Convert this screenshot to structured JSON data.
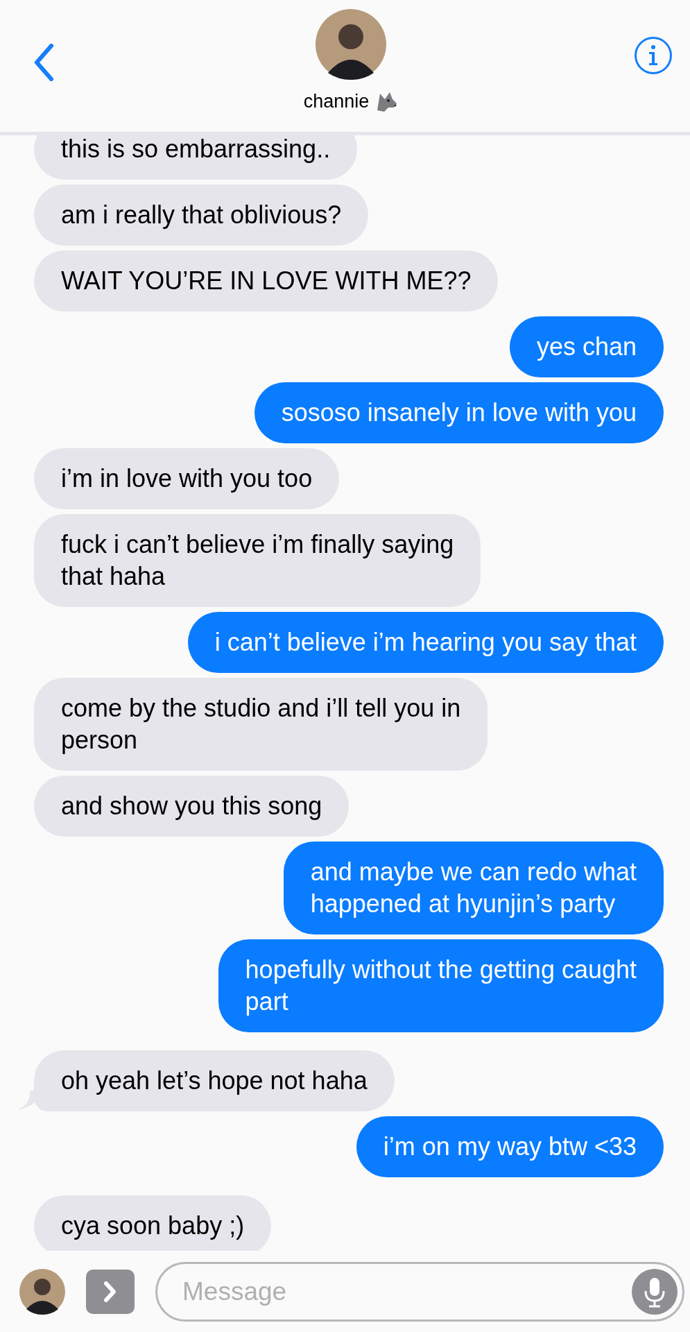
{
  "header": {
    "contact_name": "channie"
  },
  "groups": [
    {
      "messages": [
        {
          "kind": "received",
          "text": "this is so embarrassing..",
          "tail": false
        },
        {
          "kind": "received",
          "text": "am i really that oblivious?",
          "tail": false
        },
        {
          "kind": "received",
          "text": "WAIT YOU’RE IN LOVE WITH ME??",
          "tail": false
        },
        {
          "kind": "sent",
          "text": "yes chan",
          "tail": false
        },
        {
          "kind": "sent",
          "text": "sososo insanely in love with you",
          "tail": false
        },
        {
          "kind": "received",
          "text": "i’m in love with you too",
          "tail": false
        },
        {
          "kind": "received",
          "text": "fuck i can’t believe i’m finally saying\nthat haha",
          "tail": false
        },
        {
          "kind": "sent",
          "text": "i can’t believe i’m hearing you say that",
          "tail": false
        },
        {
          "kind": "received",
          "text": "come by the studio and i’ll tell you in\nperson",
          "tail": false
        },
        {
          "kind": "received",
          "text": "and show you this song",
          "tail": false
        },
        {
          "kind": "sent",
          "text": "and maybe we can redo what\nhappened at hyunjin’s party",
          "tail": false
        },
        {
          "kind": "sent",
          "text": "hopefully without the getting caught\npart",
          "tail": false
        }
      ]
    },
    {
      "messages": [
        {
          "kind": "received",
          "text": "oh yeah let’s hope not haha",
          "tail": true
        },
        {
          "kind": "sent",
          "text": "i’m on my way btw <33",
          "tail": false
        }
      ]
    },
    {
      "messages": [
        {
          "kind": "received",
          "text": "cya soon baby ;)",
          "tail": false
        }
      ]
    }
  ],
  "composer": {
    "placeholder": "Message"
  }
}
